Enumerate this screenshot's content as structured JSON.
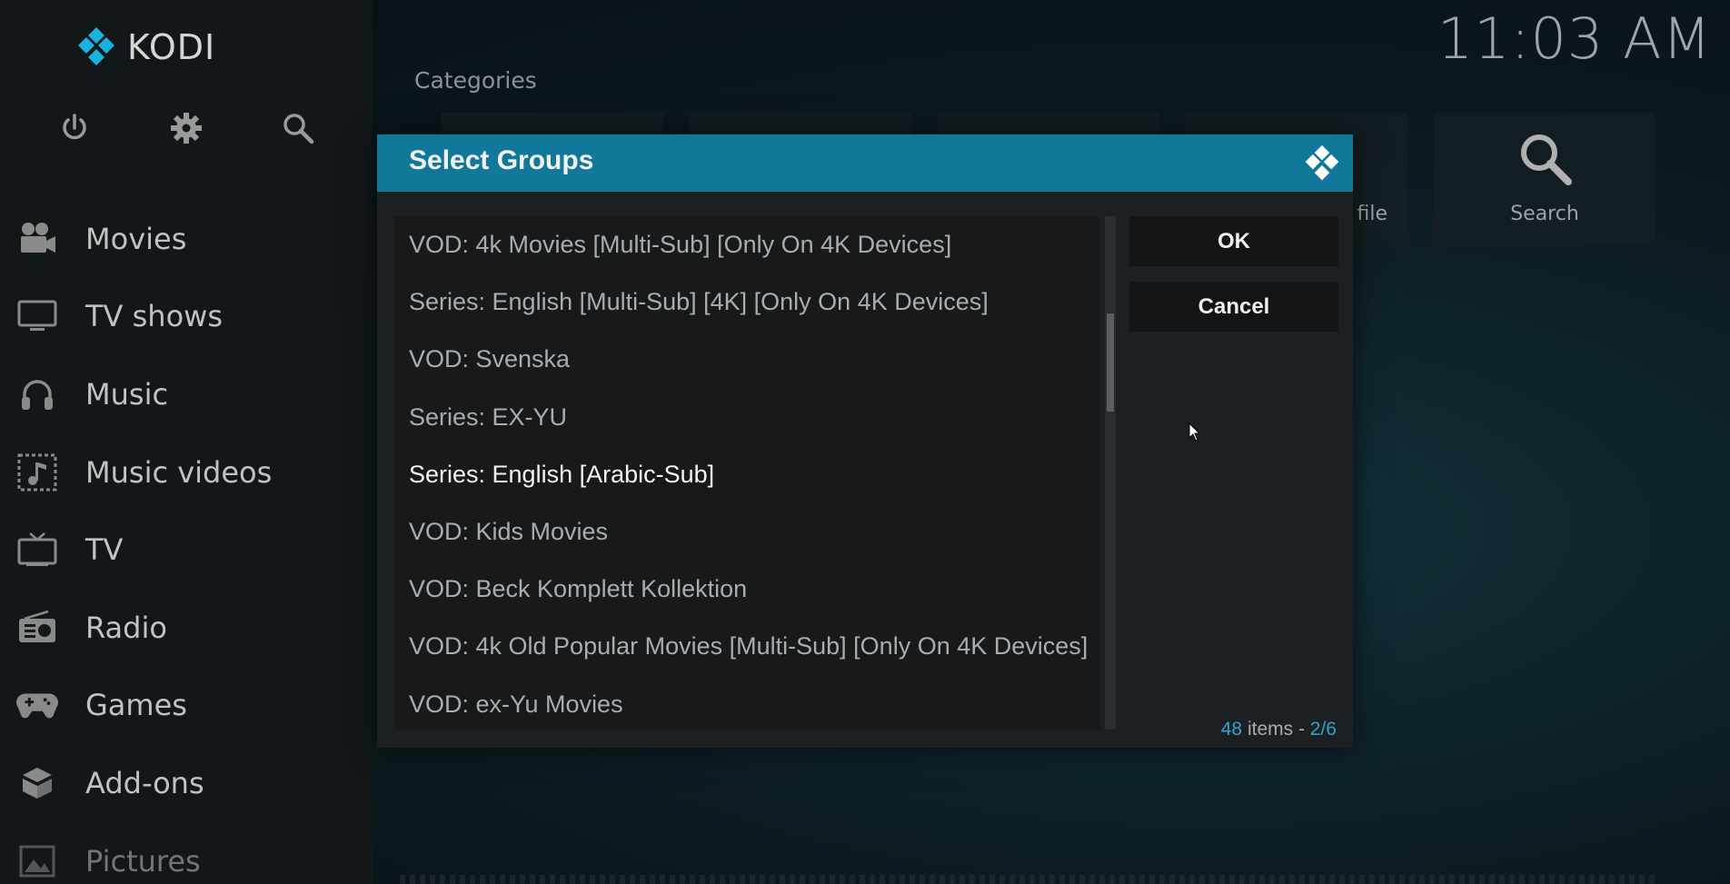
{
  "app": {
    "name": "KODI",
    "time": "11:03 AM"
  },
  "colors": {
    "accent": "#12789a",
    "highlight": "#2ea3cc"
  },
  "sidebar": {
    "top_icons": [
      {
        "icon": "power-icon"
      },
      {
        "icon": "gear-icon"
      },
      {
        "icon": "search-icon"
      }
    ],
    "items": [
      {
        "label": "Movies",
        "icon": "movie-camera-icon"
      },
      {
        "label": "TV shows",
        "icon": "monitor-icon"
      },
      {
        "label": "Music",
        "icon": "headphones-icon"
      },
      {
        "label": "Music videos",
        "icon": "music-video-icon"
      },
      {
        "label": "TV",
        "icon": "tv-icon"
      },
      {
        "label": "Radio",
        "icon": "radio-icon"
      },
      {
        "label": "Games",
        "icon": "gamepad-icon"
      },
      {
        "label": "Add-ons",
        "icon": "box-icon"
      },
      {
        "label": "Pictures",
        "icon": "picture-icon"
      }
    ]
  },
  "background": {
    "section_title": "Categories",
    "tiles": [
      {
        "label": ""
      },
      {
        "label": ""
      },
      {
        "label": ""
      },
      {
        "label": "file"
      },
      {
        "label": "Search",
        "icon": "search-icon"
      }
    ]
  },
  "dialog": {
    "title": "Select Groups",
    "items": [
      "VOD: 4k Movies [Multi-Sub] [Only On 4K Devices]",
      "Series: English [Multi-Sub] [4K] [Only On 4K Devices]",
      "VOD: Svenska",
      "Series: EX-YU",
      "Series: English [Arabic-Sub]",
      "VOD: Kids Movies",
      "VOD: Beck Komplett Kollektion",
      "VOD: 4k Old Popular Movies [Multi-Sub] [Only On 4K Devices]",
      "VOD: ex-Yu Movies"
    ],
    "focused_index": 4,
    "scroll_position_fraction": 0.19,
    "ok_label": "OK",
    "cancel_label": "Cancel",
    "status": {
      "count": "48",
      "items_text": "items -",
      "page": "2/6"
    }
  }
}
